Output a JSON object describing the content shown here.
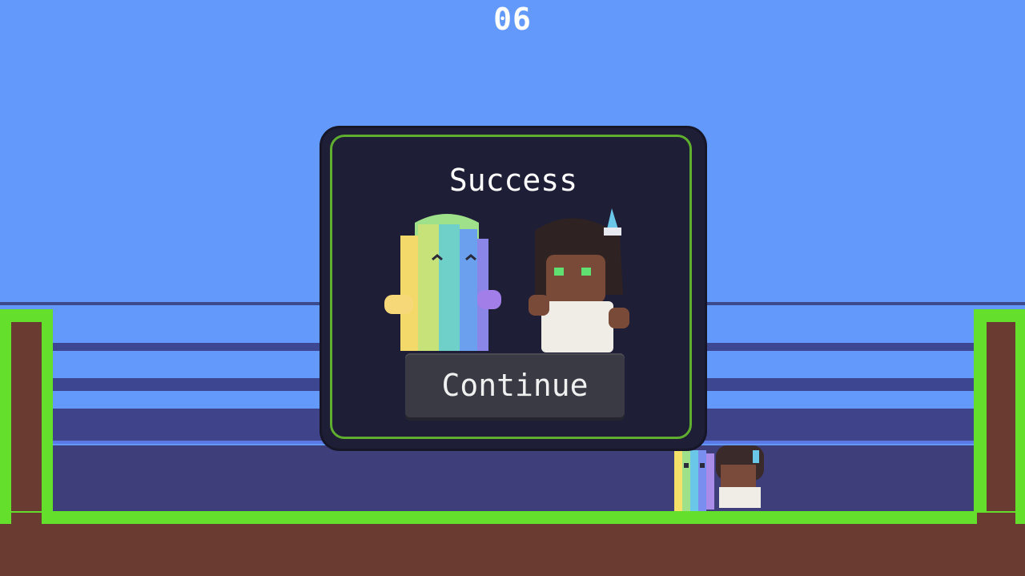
{
  "hud": {
    "counter": "06"
  },
  "dialog": {
    "title": "Success",
    "button_label": "Continue"
  },
  "colors": {
    "sky": "#6399fb",
    "grass": "#64e02c",
    "dirt": "#6a3c31",
    "dialog_bg": "#1e1e36",
    "dialog_border": "#5fae30",
    "button_bg": "#3a3a44"
  },
  "characters": [
    {
      "name": "rainbow-blob",
      "icon": "rainbow-character"
    },
    {
      "name": "dark-haired-kid",
      "icon": "kid-character"
    }
  ]
}
